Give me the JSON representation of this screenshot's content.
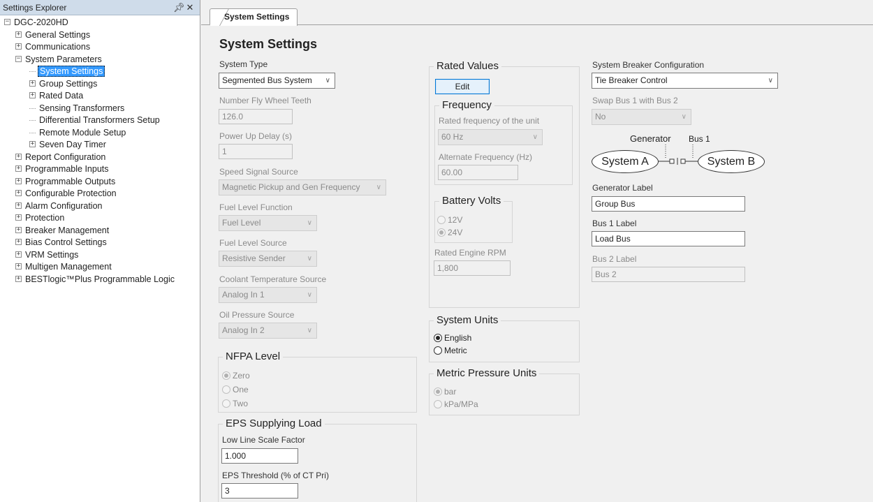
{
  "explorer": {
    "title": "Settings Explorer",
    "pin_icon": "pin-icon",
    "close_icon": "close-icon",
    "tree": [
      {
        "label": "DGC-2020HD",
        "level": 0,
        "node": "collapse"
      },
      {
        "label": "General Settings",
        "level": 1,
        "node": "expand"
      },
      {
        "label": "Communications",
        "level": 1,
        "node": "expand"
      },
      {
        "label": "System Parameters",
        "level": 1,
        "node": "collapse"
      },
      {
        "label": "System Settings",
        "level": 2,
        "node": "leaf",
        "selected": true
      },
      {
        "label": "Group Settings",
        "level": 2,
        "node": "expand"
      },
      {
        "label": "Rated Data",
        "level": 2,
        "node": "expand"
      },
      {
        "label": "Sensing Transformers",
        "level": 2,
        "node": "leaf"
      },
      {
        "label": "Differential Transformers Setup",
        "level": 2,
        "node": "leaf"
      },
      {
        "label": "Remote Module Setup",
        "level": 2,
        "node": "leaf"
      },
      {
        "label": "Seven Day Timer",
        "level": 2,
        "node": "expand"
      },
      {
        "label": "Report Configuration",
        "level": 1,
        "node": "expand"
      },
      {
        "label": "Programmable Inputs",
        "level": 1,
        "node": "expand"
      },
      {
        "label": "Programmable Outputs",
        "level": 1,
        "node": "expand"
      },
      {
        "label": "Configurable Protection",
        "level": 1,
        "node": "expand"
      },
      {
        "label": "Alarm Configuration",
        "level": 1,
        "node": "expand"
      },
      {
        "label": "Protection",
        "level": 1,
        "node": "expand"
      },
      {
        "label": "Breaker Management",
        "level": 1,
        "node": "expand"
      },
      {
        "label": "Bias Control Settings",
        "level": 1,
        "node": "expand"
      },
      {
        "label": "VRM Settings",
        "level": 1,
        "node": "expand"
      },
      {
        "label": "Multigen Management",
        "level": 1,
        "node": "expand"
      },
      {
        "label": "BESTlogic™Plus Programmable Logic",
        "level": 1,
        "node": "expand"
      }
    ]
  },
  "tab": {
    "label": "System Settings"
  },
  "page": {
    "title": "System Settings"
  },
  "col1": {
    "system_type_label": "System Type",
    "system_type_value": "Segmented Bus System",
    "flywheel_label": "Number Fly Wheel Teeth",
    "flywheel_value": "126.0",
    "powerup_label": "Power Up Delay (s)",
    "powerup_value": "1",
    "speed_label": "Speed Signal Source",
    "speed_value": "Magnetic Pickup and Gen Frequency",
    "fuel_func_label": "Fuel Level Function",
    "fuel_func_value": "Fuel Level",
    "fuel_src_label": "Fuel Level Source",
    "fuel_src_value": "Resistive Sender",
    "coolant_label": "Coolant Temperature Source",
    "coolant_value": "Analog In 1",
    "oil_label": "Oil Pressure Source",
    "oil_value": "Analog In 2"
  },
  "nfpa": {
    "title": "NFPA Level",
    "options": [
      "Zero",
      "One",
      "Two"
    ],
    "selected": "Zero"
  },
  "eps": {
    "title": "EPS Supplying Load",
    "scale_label": "Low Line Scale Factor",
    "scale_value": "1.000",
    "threshold_label": "EPS Threshold (% of CT Pri)",
    "threshold_value": "3"
  },
  "rated": {
    "title": "Rated Values",
    "edit_label": "Edit",
    "freq_title": "Frequency",
    "rated_freq_label": "Rated frequency of the unit",
    "rated_freq_value": "60 Hz",
    "alt_freq_label": "Alternate Frequency (Hz)",
    "alt_freq_value": "60.00",
    "battery_title": "Battery Volts",
    "battery_options": [
      "12V",
      "24V"
    ],
    "battery_selected": "24V",
    "rpm_label": "Rated Engine RPM",
    "rpm_value": "1,800"
  },
  "units": {
    "title": "System Units",
    "options": [
      "English",
      "Metric"
    ],
    "selected": "English"
  },
  "pressure": {
    "title": "Metric Pressure Units",
    "options": [
      "bar",
      "kPa/MPa"
    ],
    "selected": "bar"
  },
  "breaker": {
    "config_label": "System Breaker Configuration",
    "config_value": "Tie Breaker Control",
    "swap_label": "Swap Bus 1 with Bus 2",
    "swap_value": "No",
    "diagram": {
      "generator_tag": "Generator",
      "bus1_tag": "Bus 1",
      "system_a": "System A",
      "system_b": "System B"
    },
    "gen_label_label": "Generator Label",
    "gen_label_value": "Group Bus",
    "bus1_label_label": "Bus 1 Label",
    "bus1_label_value": "Load Bus",
    "bus2_label_label": "Bus 2 Label",
    "bus2_label_value": "Bus 2"
  },
  "colors": {
    "selection": "#3399ff",
    "edit_border": "#0078d7",
    "explorer_header": "#cfdcea"
  }
}
